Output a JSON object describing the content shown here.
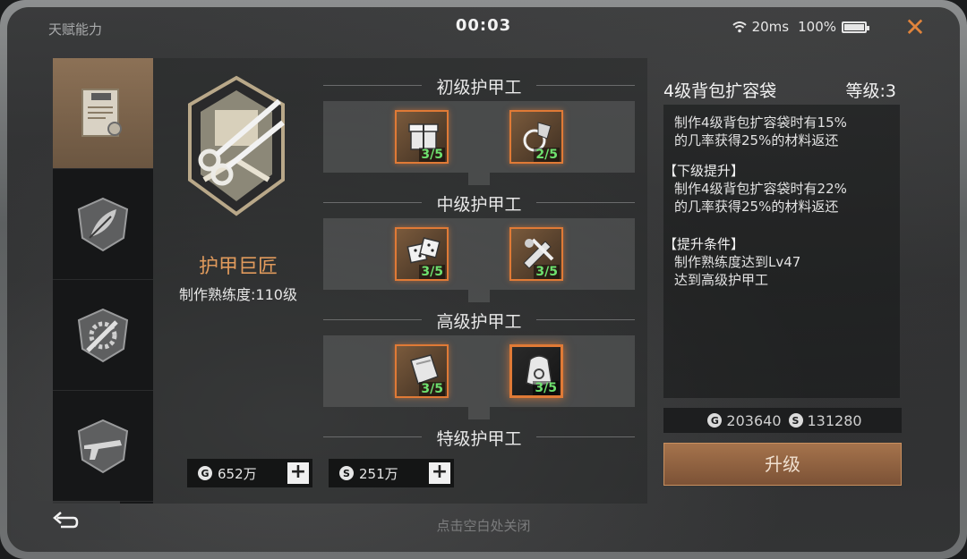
{
  "header": {
    "title": "天赋能力",
    "clock": "00:03",
    "ping": "20ms",
    "battery": "100%",
    "battery_level": 1.0,
    "close_icon": "close-x-icon"
  },
  "tabs": [
    {
      "icon": "trade-certificate-icon",
      "active": true
    },
    {
      "icon": "leaf-shield-icon",
      "active": false
    },
    {
      "icon": "gear-wrench-shield-icon",
      "active": false
    },
    {
      "icon": "gun-shield-icon",
      "active": false
    }
  ],
  "talent": {
    "name": "护甲巨匠",
    "proficiency": "制作熟练度:110级",
    "emblem_icon": "scissors-armor-emblem-icon"
  },
  "resources": [
    {
      "currency_icon": "gold-coin-icon",
      "symbol": "G",
      "value": "652万",
      "plus_icon": "plus-icon"
    },
    {
      "currency_icon": "silver-coin-icon",
      "symbol": "S",
      "value": "251万",
      "plus_icon": "plus-icon"
    }
  ],
  "tiers": [
    {
      "title": "初级护甲工",
      "skills": [
        {
          "icon": "gift-box-icon",
          "count": "3/5"
        },
        {
          "icon": "lantern-icon",
          "count": "2/5"
        }
      ]
    },
    {
      "title": "中级护甲工",
      "skills": [
        {
          "icon": "dice-icon",
          "count": "3/5"
        },
        {
          "icon": "tools-bundle-icon",
          "count": "3/5"
        }
      ]
    },
    {
      "title": "高级护甲工",
      "skills": [
        {
          "icon": "cloth-pouch-icon",
          "count": "3/5"
        },
        {
          "icon": "backpack-icon",
          "count": "3/5",
          "selected": true
        }
      ]
    },
    {
      "title": "特级护甲工",
      "skills": []
    }
  ],
  "detail": {
    "title": "4级背包扩容袋",
    "level": "等级:3",
    "current_line1": "制作4级背包扩容袋时有15%",
    "current_line2": "的几率获得25%的材料返还",
    "next_header": "【下级提升】",
    "next_line1": "制作4级背包扩容袋时有22%",
    "next_line2": "的几率获得25%的材料返还",
    "req_header": "【提升条件】",
    "req_line1": "制作熟练度达到Lv47",
    "req_line2": "达到高级护甲工",
    "cost_gold": "203640",
    "cost_silver": "131280",
    "upgrade_label": "升级"
  },
  "footer": {
    "back_icon": "back-arrow-icon",
    "hint": "点击空白处关闭"
  }
}
